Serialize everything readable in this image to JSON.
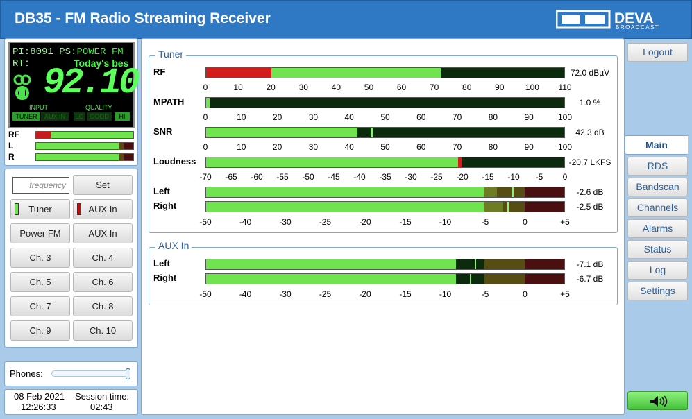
{
  "header": {
    "title": "DB35 - FM Radio Streaming Receiver",
    "logo_text": "DEVA",
    "logo_sub": "BROADCAST"
  },
  "display": {
    "pi_label": "PI:",
    "pi": "8091",
    "ps_label": "PS:",
    "ps": "POWER FM",
    "rt_label": "RT:",
    "rt": "Today's bes",
    "frequency": "92.10",
    "input_label": "INPUT",
    "quality_label": "QUALITY",
    "tuner": "TUNER",
    "auxin": "AUX IN",
    "lo": "LO",
    "good": "GOOD",
    "hi": "HI"
  },
  "small_meters": {
    "rf": "RF",
    "l": "L",
    "r": "R"
  },
  "controls": {
    "freq_placeholder": "frequency",
    "set": "Set",
    "tuner": "Tuner",
    "aux_in_led": "AUX In",
    "power_fm": "Power FM",
    "aux_in": "AUX In",
    "ch3": "Ch. 3",
    "ch4": "Ch. 4",
    "ch5": "Ch. 5",
    "ch6": "Ch. 6",
    "ch7": "Ch. 7",
    "ch8": "Ch. 8",
    "ch9": "Ch. 9",
    "ch10": "Ch. 10"
  },
  "phones": {
    "label": "Phones:",
    "level": 1.0
  },
  "status": {
    "date": "08 Feb 2021",
    "time": "12:26:33",
    "session_label": "Session time:",
    "session": "02:43"
  },
  "tuner": {
    "legend": "Tuner",
    "rf": {
      "label": "RF",
      "value": "72.0 dBµV",
      "level": 72,
      "min": 0,
      "max": 110,
      "ticks": [
        "0",
        "10",
        "20",
        "30",
        "40",
        "50",
        "60",
        "70",
        "80",
        "90",
        "100",
        "110"
      ]
    },
    "mpath": {
      "label": "MPATH",
      "value": "1.0 %",
      "level": 1,
      "min": 0,
      "max": 100,
      "ticks": [
        "0",
        "10",
        "20",
        "30",
        "40",
        "50",
        "60",
        "70",
        "80",
        "90",
        "100"
      ]
    },
    "snr": {
      "label": "SNR",
      "value": "42.3 dB",
      "level": 42.3,
      "peak": 46,
      "min": 0,
      "max": 100,
      "ticks": [
        "0",
        "10",
        "20",
        "30",
        "40",
        "50",
        "60",
        "70",
        "80",
        "90",
        "100"
      ]
    },
    "loudness": {
      "label": "Loudness",
      "value": "-20.7 LKFS",
      "level": -20.7,
      "min": -70,
      "max": 0,
      "ticks": [
        "-70",
        "-65",
        "-60",
        "-55",
        "-50",
        "-45",
        "-40",
        "-35",
        "-30",
        "-25",
        "-20",
        "-15",
        "-10",
        "-5",
        "0"
      ]
    },
    "left": {
      "label": "Left",
      "value": "-2.6 dB",
      "level": -3.5,
      "peak": -1.6
    },
    "right": {
      "label": "Right",
      "value": "-2.5 dB",
      "level": -2.7,
      "peak": -2.2
    },
    "db_ticks": [
      "-50",
      "-40",
      "-30",
      "-25",
      "-20",
      "-15",
      "-10",
      "-5",
      "0",
      "+5"
    ]
  },
  "aux": {
    "legend": "AUX In",
    "left": {
      "label": "Left",
      "value": "-7.1 dB",
      "level": -8.6,
      "peak": -6.3
    },
    "right": {
      "label": "Right",
      "value": "-6.7 dB",
      "level": -8.6,
      "peak": -6.9
    },
    "db_ticks": [
      "-50",
      "-40",
      "-30",
      "-25",
      "-20",
      "-15",
      "-10",
      "-5",
      "0",
      "+5"
    ]
  },
  "nav": {
    "logout": "Logout",
    "main": "Main",
    "rds": "RDS",
    "bandscan": "Bandscan",
    "channels": "Channels",
    "alarms": "Alarms",
    "status": "Status",
    "log": "Log",
    "settings": "Settings"
  },
  "colors": {
    "green": "#6fe44f",
    "red": "#d31d1d",
    "dark": "#0c2a0c",
    "accent": "#2e78c4"
  }
}
